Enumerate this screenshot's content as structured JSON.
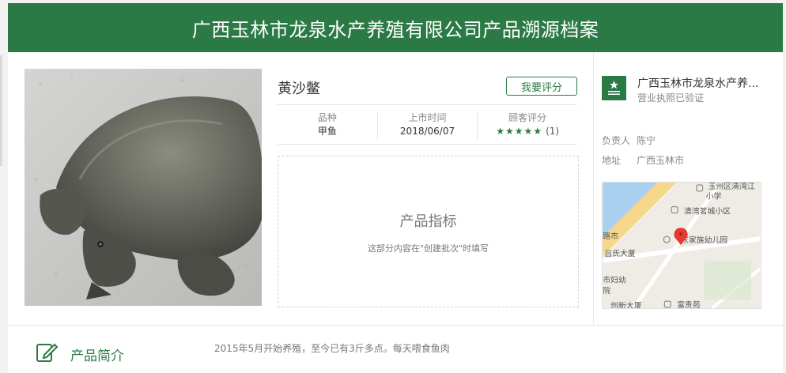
{
  "header": {
    "title": "广西玉林市龙泉水产养殖有限公司产品溯源档案"
  },
  "product": {
    "name": "黄沙鳖",
    "rate_button": "我要评分",
    "info": [
      {
        "label": "品种",
        "value": "甲鱼"
      },
      {
        "label": "上市时间",
        "value": "2018/06/07"
      },
      {
        "label": "顾客评分",
        "stars": "★★★★★",
        "count": "(1)"
      }
    ],
    "rating_stars": 5
  },
  "metrics": {
    "title": "产品指标",
    "note": "这部分内容在\"创建批次\"时填写"
  },
  "company": {
    "name": "广西玉林市龙泉水产养...",
    "verified": "营业执照已验证",
    "owner_label": "负责人",
    "owner": "陈宁",
    "address_label": "地址",
    "address": "广西玉林市",
    "map_labels": {
      "district": "玉州区清湾江",
      "school": "小学",
      "community": "清湾茗城小区",
      "kindergarten": "东家族幼儿园",
      "building": "吕氏大厦",
      "left_top": "路市",
      "hospital_1": "市妇幼",
      "hospital_2": "院",
      "tower": "创新大厦",
      "garden": "富贵苑"
    }
  },
  "intro": {
    "title": "产品简介",
    "text": "2015年5月开始养殖，至今已有3斤多点。每天喂食鱼肉"
  },
  "colors": {
    "brand": "#2b7a45",
    "pin": "#e53935"
  }
}
